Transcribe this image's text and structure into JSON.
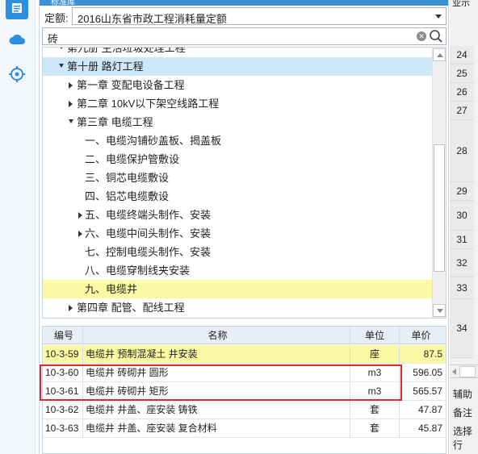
{
  "panel": {
    "header_title": "标准库"
  },
  "quota": {
    "label": "定额:",
    "value": "2016山东省市政工程消耗量定额"
  },
  "search": {
    "value": "砖"
  },
  "tree": {
    "nodes": [
      {
        "label": "第九册 生活垃圾处理工程",
        "level": 1,
        "state": "expanded",
        "style": ""
      },
      {
        "label": "第十册 路灯工程",
        "level": 1,
        "state": "expanded",
        "style": "selected"
      },
      {
        "label": "第一章 变配电设备工程",
        "level": 2,
        "state": "collapsed",
        "style": ""
      },
      {
        "label": "第二章 10kV以下架空线路工程",
        "level": 2,
        "state": "collapsed",
        "style": ""
      },
      {
        "label": "第三章 电缆工程",
        "level": 2,
        "state": "expanded",
        "style": ""
      },
      {
        "label": "一、电缆沟铺砂盖板、揭盖板",
        "level": 3,
        "state": "leaf",
        "style": ""
      },
      {
        "label": "二、电缆保护管敷设",
        "level": 3,
        "state": "leaf",
        "style": ""
      },
      {
        "label": "三、铜芯电缆敷设",
        "level": 3,
        "state": "leaf",
        "style": ""
      },
      {
        "label": "四、铝芯电缆敷设",
        "level": 3,
        "state": "leaf",
        "style": ""
      },
      {
        "label": "五、电缆终端头制作、安装",
        "level": 3,
        "state": "collapsed",
        "style": ""
      },
      {
        "label": "六、电缆中间头制作、安装",
        "level": 3,
        "state": "collapsed",
        "style": ""
      },
      {
        "label": "七、控制电缆头制作、安装",
        "level": 3,
        "state": "leaf",
        "style": ""
      },
      {
        "label": "八、电缆穿制线夹安装",
        "level": 3,
        "state": "leaf",
        "style": ""
      },
      {
        "label": "九、电缆井",
        "level": 3,
        "state": "leaf",
        "style": "highlight"
      },
      {
        "label": "第四章 配管、配线工程",
        "level": 2,
        "state": "collapsed",
        "style": ""
      }
    ]
  },
  "grid": {
    "headers": {
      "code": "编号",
      "name": "名称",
      "unit": "单位",
      "price": "单价"
    },
    "rows": [
      {
        "code": "10-3-59",
        "name": "电缆井 预制混凝土 井安装",
        "unit": "座",
        "price": "87.5",
        "highlight": true
      },
      {
        "code": "10-3-60",
        "name": "电缆井 砖砌井 圆形",
        "unit": "m3",
        "price": "596.05",
        "highlight": false
      },
      {
        "code": "10-3-61",
        "name": "电缆井 砖砌井 矩形",
        "unit": "m3",
        "price": "565.57",
        "highlight": false
      },
      {
        "code": "10-3-62",
        "name": "电缆井 井盖、座安装 铸铁",
        "unit": "套",
        "price": "47.87",
        "highlight": false
      },
      {
        "code": "10-3-63",
        "name": "电缆井 井盖、座安装 复合材料",
        "unit": "套",
        "price": "45.87",
        "highlight": false
      }
    ]
  },
  "right_panel": {
    "header": "业示",
    "row_numbers": [
      "24",
      "25",
      "26",
      "27",
      "28",
      "29",
      "30",
      "31",
      "32",
      "33",
      "34"
    ],
    "tab_aux": "辅助",
    "tab_note": "备注",
    "select_text": "选择行"
  },
  "colors": {
    "accent": "#2d8fe0",
    "highlight": "#fcf9a4",
    "selection": "#cde8f8",
    "annotation": "#e0272b"
  },
  "icons": [
    "list-icon",
    "cloud-icon",
    "target-icon",
    "search-icon",
    "clear-icon"
  ]
}
